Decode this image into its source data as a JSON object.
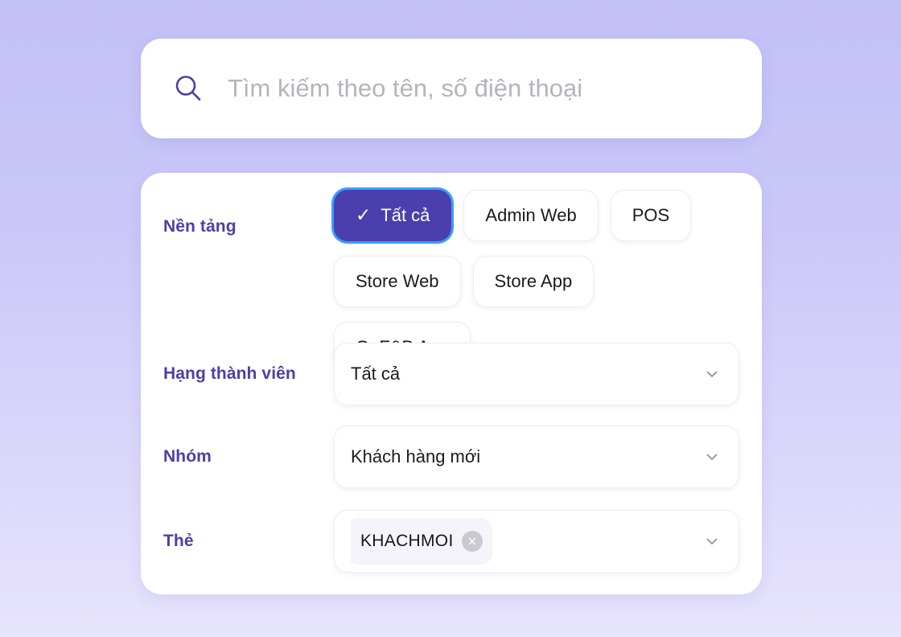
{
  "search": {
    "placeholder": "Tìm kiếm theo tên, số điện thoại",
    "value": "",
    "icon": "search-icon"
  },
  "filters": {
    "platform": {
      "label": "Nền tảng",
      "selected": "Tất cả",
      "options": [
        {
          "label": "Tất cả",
          "selected": true
        },
        {
          "label": "Admin Web",
          "selected": false
        },
        {
          "label": "POS",
          "selected": false
        },
        {
          "label": "Store Web",
          "selected": false
        },
        {
          "label": "Store App",
          "selected": false
        },
        {
          "label": "GoF&B App",
          "selected": false
        }
      ],
      "check_glyph": "✓"
    },
    "tier": {
      "label": "Hạng thành viên",
      "value": "Tất cả",
      "chevron": "chevron-down-icon"
    },
    "group": {
      "label": "Nhóm",
      "value": "Khách hàng mới",
      "chevron": "chevron-down-icon"
    },
    "tag": {
      "label": "Thẻ",
      "chips": [
        {
          "label": "KHACHMOI",
          "remove": "×"
        }
      ],
      "chevron": "chevron-down-icon"
    }
  },
  "colors": {
    "accent_purple": "#4e3ea8",
    "selected_fill": "#4b3fae",
    "focus_ring": "#3b9eff",
    "chip_bg": "#f4f4fa",
    "chip_remove": "#c9c9cf",
    "background_top": "#c3c0f7",
    "background_bottom": "#e7e4fd",
    "placeholder": "#b4b4bd"
  }
}
